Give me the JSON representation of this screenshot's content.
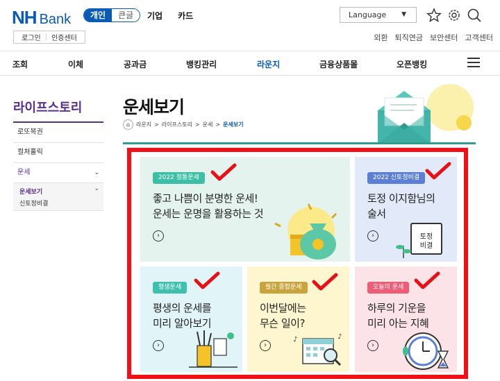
{
  "header": {
    "logo_nh": "NH",
    "logo_bank": "Bank",
    "tab_personal": "개인",
    "tab_large": "큰글",
    "link_corporate": "기업",
    "link_card": "카드",
    "language_label": "Language",
    "login": "로그인",
    "certificate": "인증센터",
    "util": [
      "외환",
      "퇴직연금",
      "보안센터",
      "고객센터"
    ]
  },
  "gnb": [
    "조회",
    "이체",
    "공과금",
    "뱅킹관리",
    "라운지",
    "금융상품몰",
    "오픈뱅킹"
  ],
  "sidebar": {
    "title": "라이프스토리",
    "items": [
      "로또복권",
      "컬쳐홀릭",
      "운세"
    ],
    "sub_active": "운세보기",
    "sub_other": "신토정비결"
  },
  "page": {
    "title": "운세보기",
    "breadcrumb": [
      "라운지",
      "라이프스토리",
      "운세",
      "운세보기"
    ]
  },
  "cards": [
    {
      "badge": "2022 정통운세",
      "line1": "좋고 나쁨이 분명한 운세!",
      "line2": "운세는 운명을 활용하는 것",
      "bg": "#e4f3ee",
      "badge_color": "#3dbfa6"
    },
    {
      "badge": "2022 신토정비결",
      "line1": "토정 이지함님의",
      "line2": "술서",
      "bg": "#e2e9f8",
      "badge_color": "#5b7fd6",
      "book_text_1": "토정",
      "book_text_2": "비결"
    },
    {
      "badge": "평생운세",
      "line1": "평생의 운세를",
      "line2": "미리 알아보기",
      "bg": "#e1f4f7",
      "badge_color": "#3fbfae"
    },
    {
      "badge": "월간 종합운세",
      "line1": "이번달에는",
      "line2": "무슨 일이?",
      "bg": "#fdf6cf",
      "badge_color": "#c9a43c"
    },
    {
      "badge": "오늘의 운세",
      "line1": "하루의 기운을",
      "line2": "미리 아는 지혜",
      "bg": "#fbe3e8",
      "badge_color": "#ee5d76"
    }
  ],
  "colors": {
    "brand_blue": "#0a5bb5",
    "lounge_purple": "#5a2e91",
    "highlight_red": "#f30f17"
  }
}
